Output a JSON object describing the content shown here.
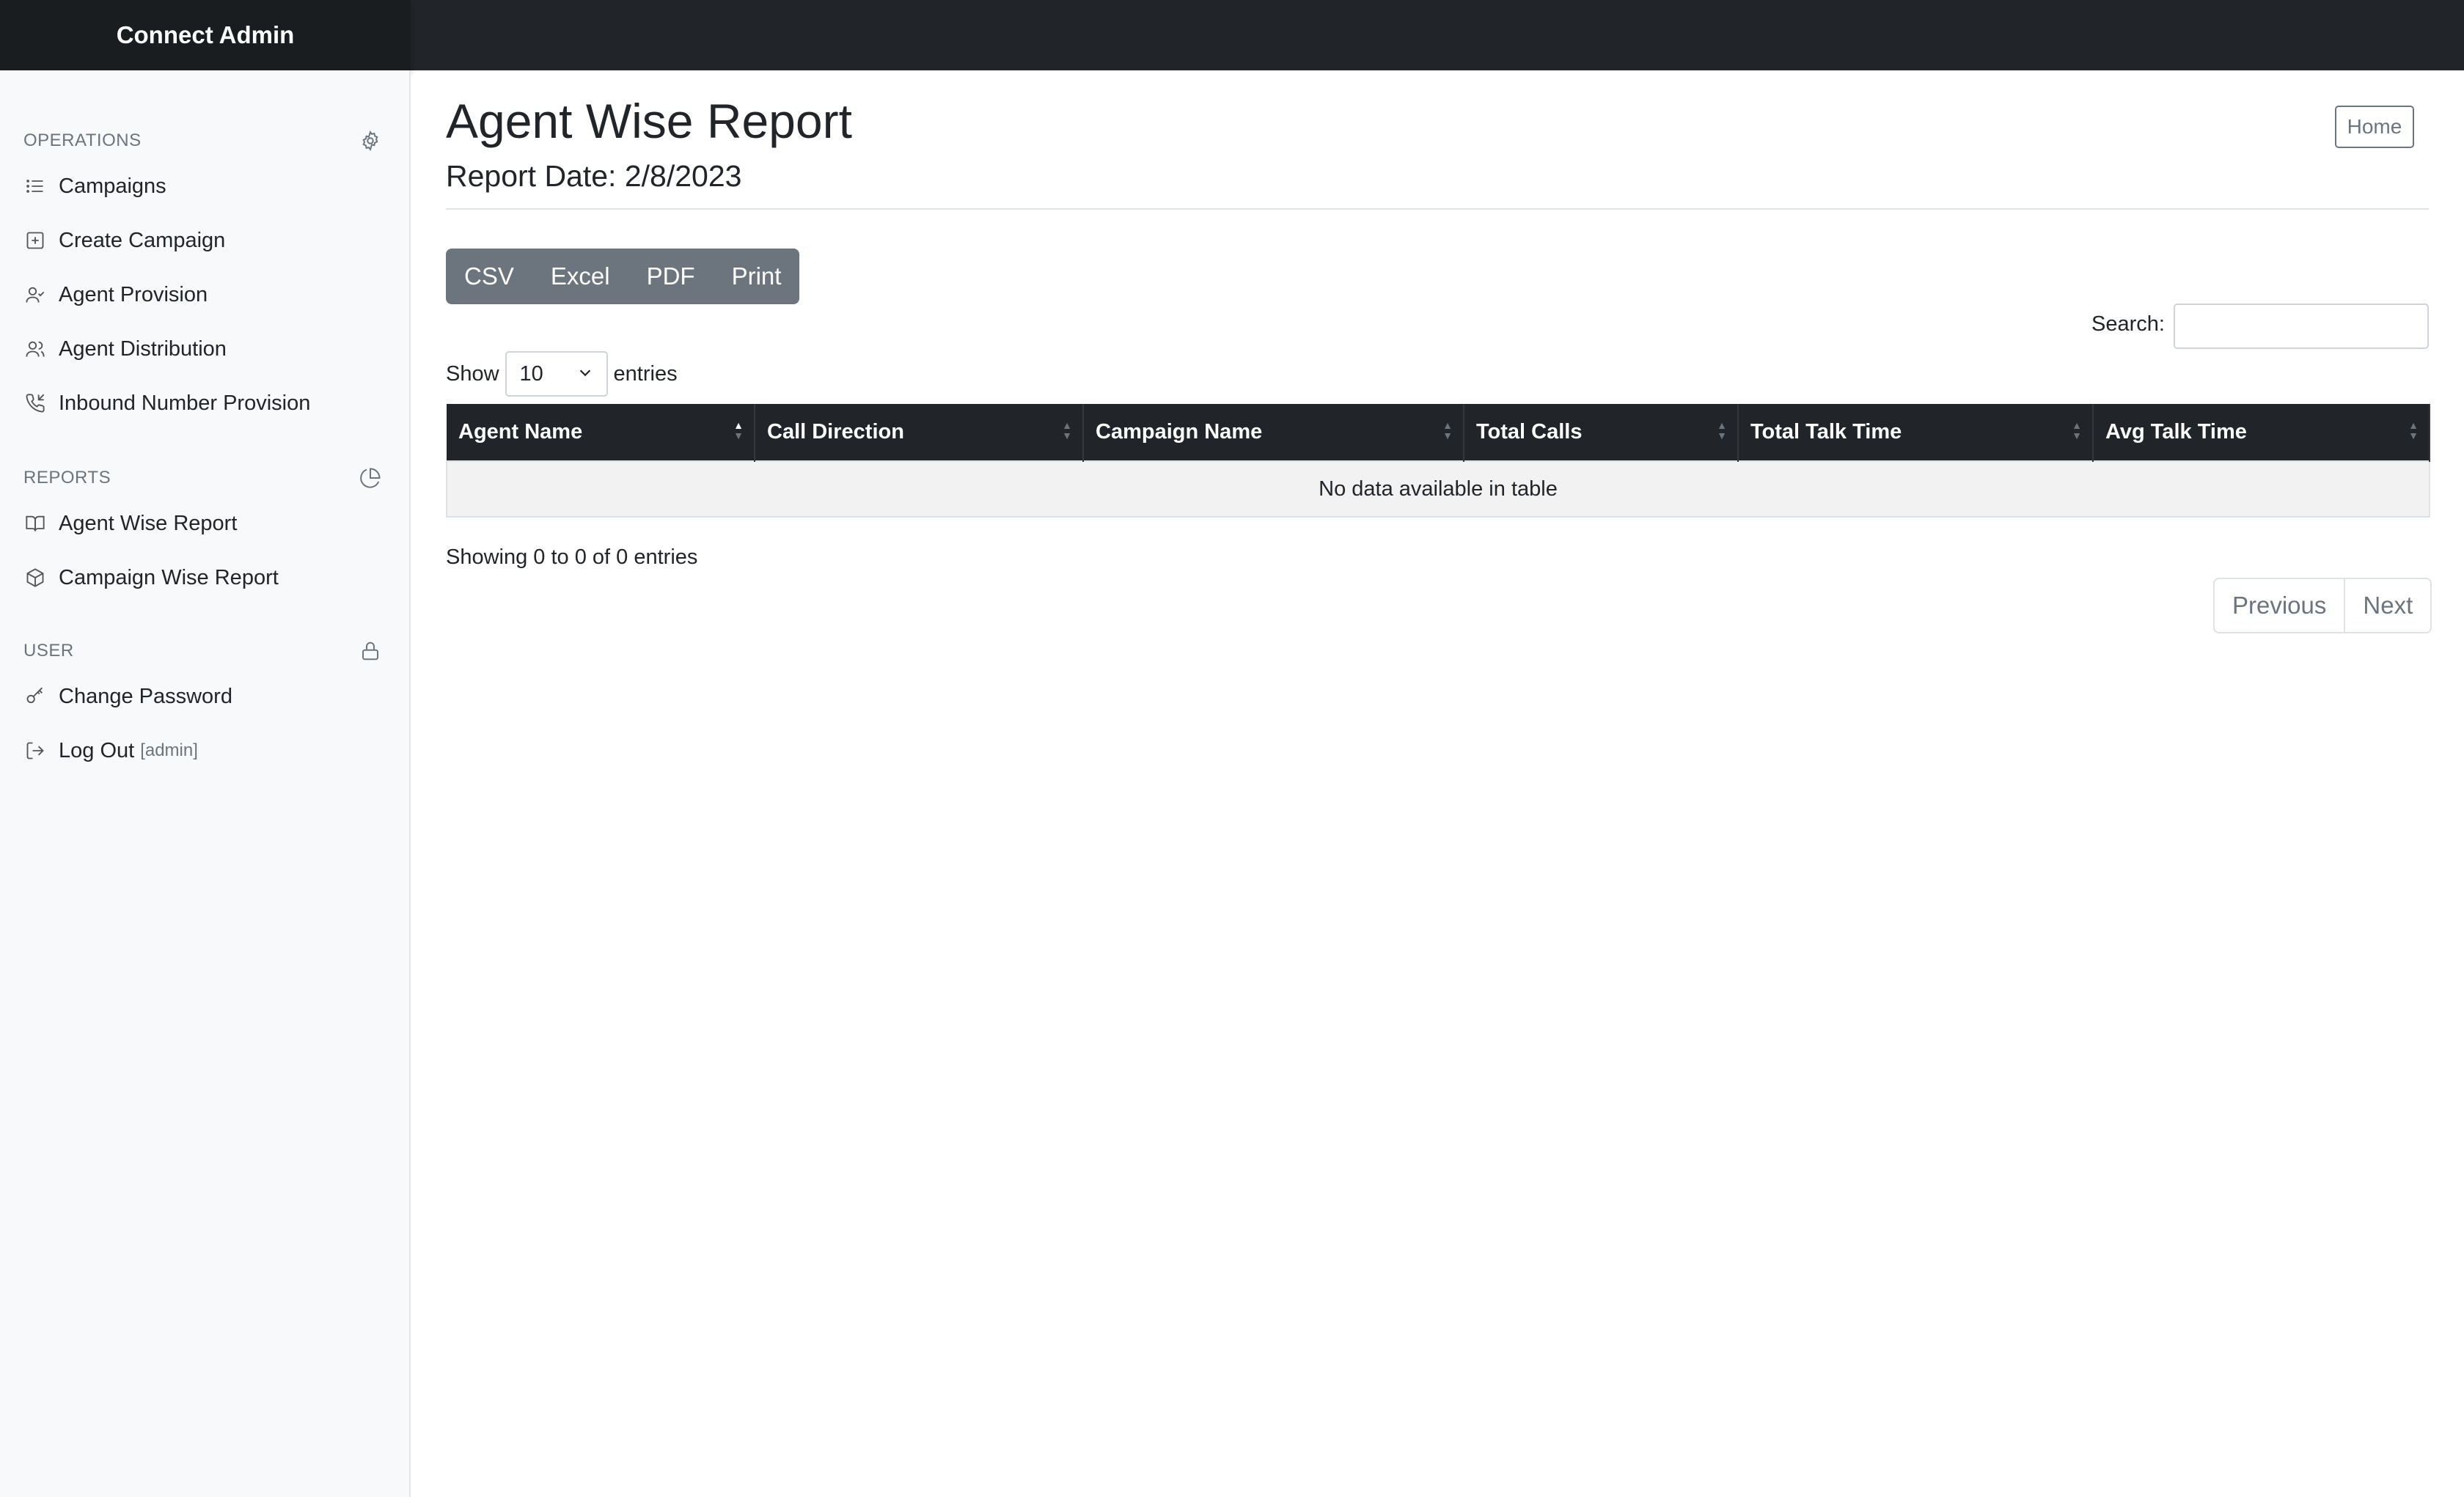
{
  "app": {
    "title": "Connect Admin"
  },
  "sidebar": {
    "sections": [
      {
        "heading": "OPERATIONS",
        "icon": "gear-icon",
        "items": [
          {
            "label": "Campaigns",
            "icon": "list-icon"
          },
          {
            "label": "Create Campaign",
            "icon": "plus-square-icon"
          },
          {
            "label": "Agent Provision",
            "icon": "user-check-icon"
          },
          {
            "label": "Agent Distribution",
            "icon": "users-icon"
          },
          {
            "label": "Inbound Number Provision",
            "icon": "phone-incoming-icon"
          }
        ]
      },
      {
        "heading": "REPORTS",
        "icon": "pie-chart-icon",
        "items": [
          {
            "label": "Agent Wise Report",
            "icon": "book-open-icon"
          },
          {
            "label": "Campaign Wise Report",
            "icon": "box-icon"
          }
        ]
      },
      {
        "heading": "USER",
        "icon": "lock-icon",
        "items": [
          {
            "label": "Change Password",
            "icon": "key-icon"
          },
          {
            "label": "Log Out",
            "suffix": "[admin]",
            "icon": "log-out-icon"
          }
        ]
      }
    ]
  },
  "page": {
    "title": "Agent Wise Report",
    "report_date": "Report Date: 2/8/2023",
    "home_label": "Home"
  },
  "export_buttons": [
    "CSV",
    "Excel",
    "PDF",
    "Print"
  ],
  "search": {
    "label": "Search:",
    "value": ""
  },
  "length": {
    "show": "Show",
    "value": "10",
    "entries": "entries"
  },
  "table": {
    "columns": [
      "Agent Name",
      "Call Direction",
      "Campaign Name",
      "Total Calls",
      "Total Talk Time",
      "Avg Talk Time"
    ],
    "empty_message": "No data available in table"
  },
  "info": "Showing 0 to 0 of 0 entries",
  "pagination": {
    "previous": "Previous",
    "next": "Next"
  }
}
